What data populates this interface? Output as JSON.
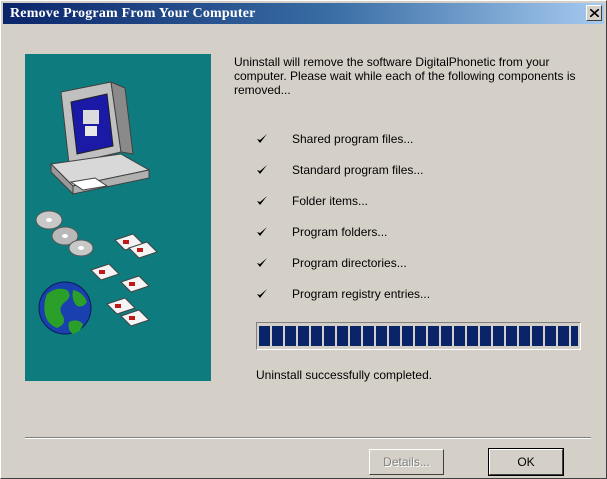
{
  "window": {
    "title": "Remove Program From Your Computer",
    "close_icon": "close-icon"
  },
  "message": {
    "intro": "Uninstall will remove the software DigitalPhonetic from your computer. Please wait while each of the following components is removed..."
  },
  "components": [
    {
      "label": "Shared program files...",
      "done": true
    },
    {
      "label": "Standard program files...",
      "done": true
    },
    {
      "label": "Folder items...",
      "done": true
    },
    {
      "label": "Program folders...",
      "done": true
    },
    {
      "label": "Program directories...",
      "done": true
    },
    {
      "label": "Program registry entries...",
      "done": true
    }
  ],
  "progress": {
    "value": 1.0,
    "color": "#0a246a"
  },
  "status": {
    "text": "Uninstall successfully completed."
  },
  "buttons": {
    "details": "Details...",
    "ok": "OK"
  },
  "colors": {
    "panel": "#0e7c7e",
    "face": "#d4d0c8",
    "titlebar": "#0a246a"
  }
}
